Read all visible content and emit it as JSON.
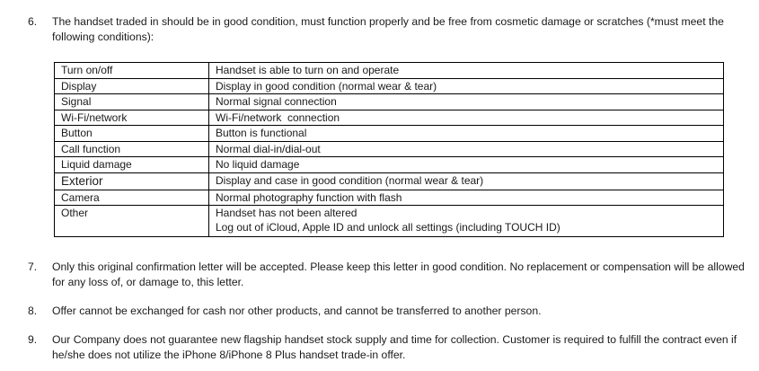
{
  "items": [
    {
      "num": "6.",
      "text": "The handset traded in should be in good condition, must function properly and be free from cosmetic damage or scratches (*must meet the following conditions):"
    },
    {
      "num": "7.",
      "text": "Only this original confirmation letter will be accepted. Please keep this letter in good condition. No replacement or compensation will be allowed for any loss of, or damage to, this letter."
    },
    {
      "num": "8.",
      "text": "Offer cannot be exchanged for cash nor other products, and cannot be transferred to another person."
    },
    {
      "num": "9.",
      "text": "Our Company does not guarantee new flagship handset stock supply and time for collection. Customer is required to fulfill the contract even if he/she does not utilize the iPhone 8/iPhone 8 Plus handset trade-in offer."
    }
  ],
  "conditions": [
    {
      "item": "Turn on/off",
      "requirement": "Handset is able to turn on and operate"
    },
    {
      "item": "Display",
      "requirement": "Display in good condition (normal wear & tear)"
    },
    {
      "item": "Signal",
      "requirement": "Normal signal connection"
    },
    {
      "item": "Wi-Fi/network",
      "requirement": "Wi-Fi/network  connection"
    },
    {
      "item": "Button",
      "requirement": "Button is functional"
    },
    {
      "item": "Call function",
      "requirement": "Normal dial-in/dial-out"
    },
    {
      "item": "Liquid damage",
      "requirement": "No liquid damage"
    },
    {
      "item": "Exterior",
      "requirement": "Display and case in good condition (normal wear & tear)"
    },
    {
      "item": "Camera",
      "requirement": "Normal photography function with flash"
    },
    {
      "item": "Other",
      "requirement": "Handset has not been altered",
      "requirement_2": "Log out of iCloud, Apple ID and unlock all settings (including TOUCH ID)"
    }
  ]
}
